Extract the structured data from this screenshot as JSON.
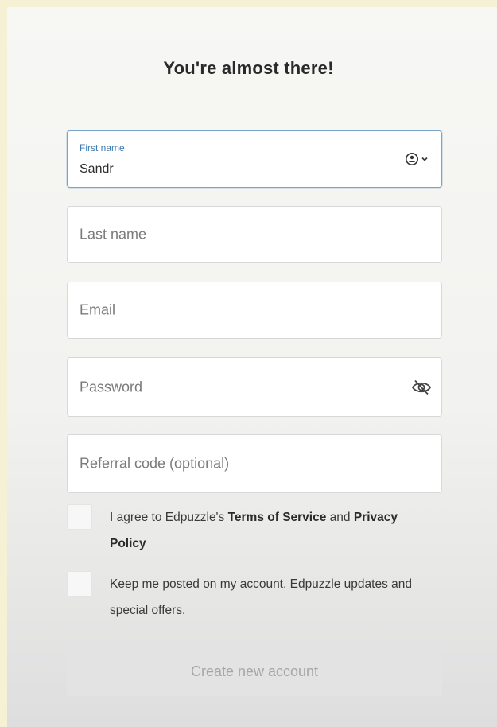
{
  "form": {
    "title": "You're almost there!",
    "first_name": {
      "label": "First name",
      "value": "Sandr"
    },
    "last_name": {
      "placeholder": "Last name"
    },
    "email": {
      "placeholder": "Email"
    },
    "password": {
      "placeholder": "Password"
    },
    "referral": {
      "placeholder": "Referral code (optional)"
    },
    "terms": {
      "prefix": "I agree to Edpuzzle's ",
      "terms_link": "Terms of Service",
      "middle": " and ",
      "privacy_link": "Privacy Policy"
    },
    "updates": {
      "text": "Keep me posted on my account, Edpuzzle updates and special offers."
    },
    "submit_label": "Create new account"
  },
  "icons": {
    "autofill": "contact-autofill-icon",
    "password_toggle": "eye-slash-icon"
  },
  "colors": {
    "focus_border": "#7aa3c9",
    "label_blue": "#3d7bb0",
    "page_background": "#f6f1d4"
  }
}
